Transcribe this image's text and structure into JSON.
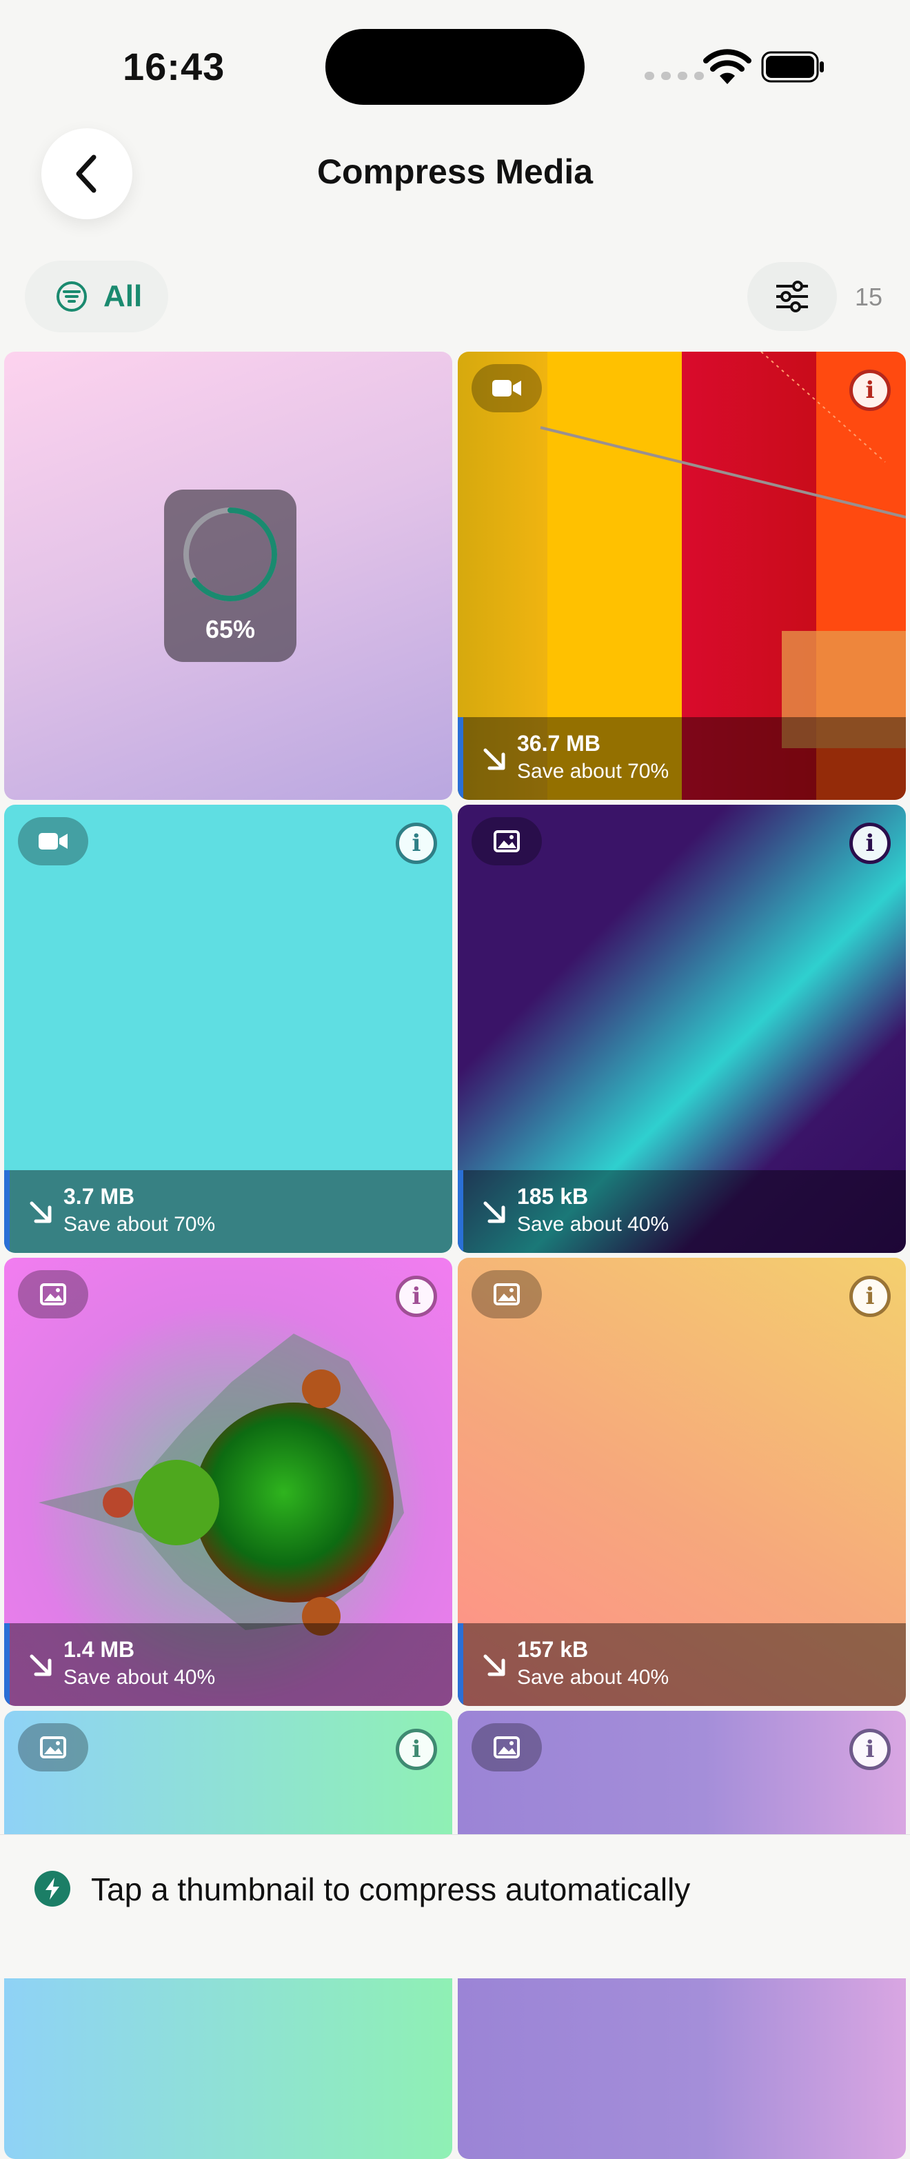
{
  "status_bar": {
    "time": "16:43"
  },
  "header": {
    "title": "Compress Media",
    "back_icon": "chevron-left-icon"
  },
  "filter": {
    "label": "All",
    "icon": "filter-lines-icon",
    "settings_icon": "sliders-icon",
    "count": "15"
  },
  "progress": {
    "value": 0.65,
    "label": "65%"
  },
  "tiles": [
    {
      "type": "processing"
    },
    {
      "type": "video",
      "size": "36.7 MB",
      "save": "Save about 70%",
      "info_color": "#b5281d"
    },
    {
      "type": "video",
      "size": "3.7 MB",
      "save": "Save about 70%",
      "info_color": "#2f7f86"
    },
    {
      "type": "image",
      "size": "185 kB",
      "save": "Save about 40%",
      "info_color": "#2a0e4c"
    },
    {
      "type": "image",
      "size": "1.4 MB",
      "save": "Save about 40%",
      "info_color": "#a04f95"
    },
    {
      "type": "image",
      "size": "157 kB",
      "save": "Save about 40%",
      "info_color": "#9a7436"
    },
    {
      "type": "image",
      "info_color": "#3f8a72"
    },
    {
      "type": "image",
      "info_color": "#6e5a8a"
    }
  ],
  "colors": {
    "accent": "#1a8a6f",
    "caption_stripe": "#2a6fd6"
  },
  "bottom_tip": {
    "icon": "bolt-icon",
    "text": "Tap a thumbnail to compress automatically"
  }
}
